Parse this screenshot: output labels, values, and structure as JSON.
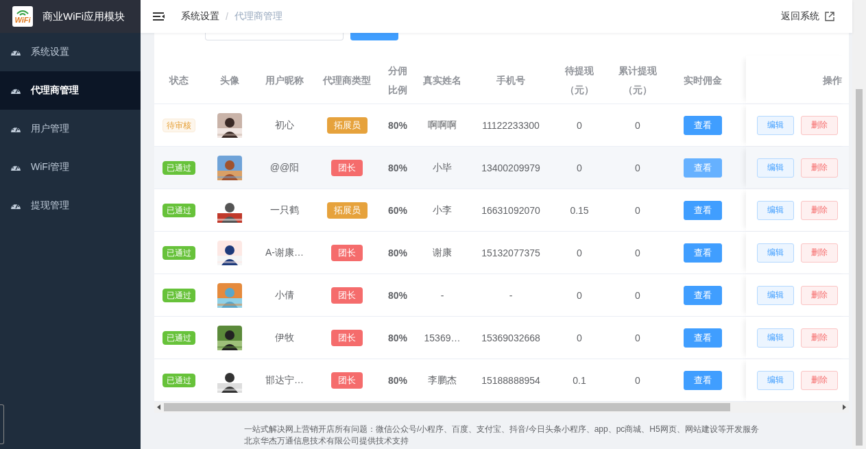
{
  "sidebar": {
    "logo": {
      "text": "WiFi"
    },
    "title": "商业WiFi应用模块",
    "items": [
      {
        "label": "系统设置",
        "selected": false
      },
      {
        "label": "代理商管理",
        "selected": true
      },
      {
        "label": "用户管理",
        "selected": false
      },
      {
        "label": "WiFi管理",
        "selected": false
      },
      {
        "label": "提现管理",
        "selected": false
      }
    ]
  },
  "header": {
    "breadcrumb": [
      "系统设置",
      "代理商管理"
    ],
    "separator": "/",
    "back_link": "返回系统"
  },
  "table": {
    "columns": [
      "状态",
      "头像",
      "用户昵称",
      "代理商类型",
      "分佣比例",
      "真实姓名",
      "手机号",
      "待提现（元）",
      "累计提现（元）",
      "实时佣金",
      "操作"
    ],
    "rows": [
      {
        "status": {
          "text": "待审核",
          "kind": "pending"
        },
        "nickname": "初心",
        "type": {
          "text": "拓展员",
          "color": "#e6a23c"
        },
        "ratio": "80%",
        "real_name": "啊啊啊",
        "phone": "11122233300",
        "pending": "0",
        "total": "0",
        "view": "查看",
        "edit": "编辑",
        "delete": "删除",
        "highlighted": false
      },
      {
        "status": {
          "text": "已通过",
          "kind": "approved"
        },
        "nickname": "@@阳",
        "type": {
          "text": "团长",
          "color": "#f56c6c"
        },
        "ratio": "80%",
        "real_name": "小毕",
        "phone": "13400209979",
        "pending": "0",
        "total": "0",
        "view": "查看",
        "edit": "编辑",
        "delete": "删除",
        "highlighted": true
      },
      {
        "status": {
          "text": "已通过",
          "kind": "approved"
        },
        "nickname": "一只鹤",
        "type": {
          "text": "拓展员",
          "color": "#e6a23c"
        },
        "ratio": "60%",
        "real_name": "小李",
        "phone": "16631092070",
        "pending": "0.15",
        "total": "0",
        "view": "查看",
        "edit": "编辑",
        "delete": "删除",
        "highlighted": false
      },
      {
        "status": {
          "text": "已通过",
          "kind": "approved"
        },
        "nickname": "A-谢康…",
        "type": {
          "text": "团长",
          "color": "#f56c6c"
        },
        "ratio": "80%",
        "real_name": "谢康",
        "phone": "15132077375",
        "pending": "0",
        "total": "0",
        "view": "查看",
        "edit": "编辑",
        "delete": "删除",
        "highlighted": false
      },
      {
        "status": {
          "text": "已通过",
          "kind": "approved"
        },
        "nickname": "小倩",
        "type": {
          "text": "团长",
          "color": "#f56c6c"
        },
        "ratio": "80%",
        "real_name": "-",
        "phone": "-",
        "pending": "0",
        "total": "0",
        "view": "查看",
        "edit": "编辑",
        "delete": "删除",
        "highlighted": false
      },
      {
        "status": {
          "text": "已通过",
          "kind": "approved"
        },
        "nickname": "伊牧",
        "type": {
          "text": "团长",
          "color": "#f56c6c"
        },
        "ratio": "80%",
        "real_name": "15369…",
        "phone": "15369032668",
        "pending": "0",
        "total": "0",
        "view": "查看",
        "edit": "编辑",
        "delete": "删除",
        "highlighted": false
      },
      {
        "status": {
          "text": "已通过",
          "kind": "approved"
        },
        "nickname": "邯达宁…",
        "type": {
          "text": "团长",
          "color": "#f56c6c"
        },
        "ratio": "80%",
        "real_name": "李鹏杰",
        "phone": "15188888954",
        "pending": "0.1",
        "total": "0",
        "view": "查看",
        "edit": "编辑",
        "delete": "删除",
        "highlighted": false
      }
    ]
  },
  "footer": [
    "一站式解决网上营销开店所有问题：微信公众号/小程序、百度、支付宝、抖音/今日头条小程序、app、pc商城、H5网页、网站建设等开发服务",
    "北京华杰万通信息技术有限公司提供技术支持"
  ]
}
